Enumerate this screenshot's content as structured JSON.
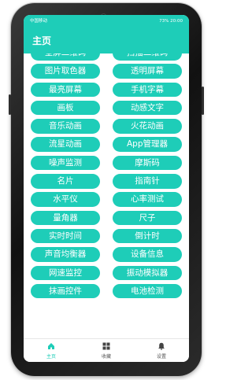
{
  "statusbar": {
    "left_text": "中国移动",
    "right_text": "73%  20:00"
  },
  "appbar": {
    "title": "主页"
  },
  "tools": [
    {
      "left": "全屏二维码",
      "right": "扫描二维码"
    },
    {
      "left": "图片取色器",
      "right": "透明屏幕"
    },
    {
      "left": "最亮屏幕",
      "right": "手机字幕"
    },
    {
      "left": "画板",
      "right": "动感文字"
    },
    {
      "left": "音乐动画",
      "right": "火花动画"
    },
    {
      "left": "流星动画",
      "right": "App管理器"
    },
    {
      "left": "噪声监测",
      "right": "摩斯码"
    },
    {
      "left": "名片",
      "right": "指南针"
    },
    {
      "left": "水平仪",
      "right": "心率测试"
    },
    {
      "left": "量角器",
      "right": "尺子"
    },
    {
      "left": "实时时间",
      "right": "倒计时"
    },
    {
      "left": "声音均衡器",
      "right": "设备信息"
    },
    {
      "left": "网速监控",
      "right": "振动模拟器"
    },
    {
      "left": "抹画控件",
      "right": "电池检测"
    }
  ],
  "bottom_nav": {
    "items": [
      {
        "label": "主页",
        "icon": "home-icon",
        "active": true
      },
      {
        "label": "收藏",
        "icon": "grid-icon",
        "active": false
      },
      {
        "label": "设置",
        "icon": "bell-icon",
        "active": false
      }
    ]
  },
  "colors": {
    "accent": "#1ecdb8",
    "nav_inactive": "#555555"
  }
}
